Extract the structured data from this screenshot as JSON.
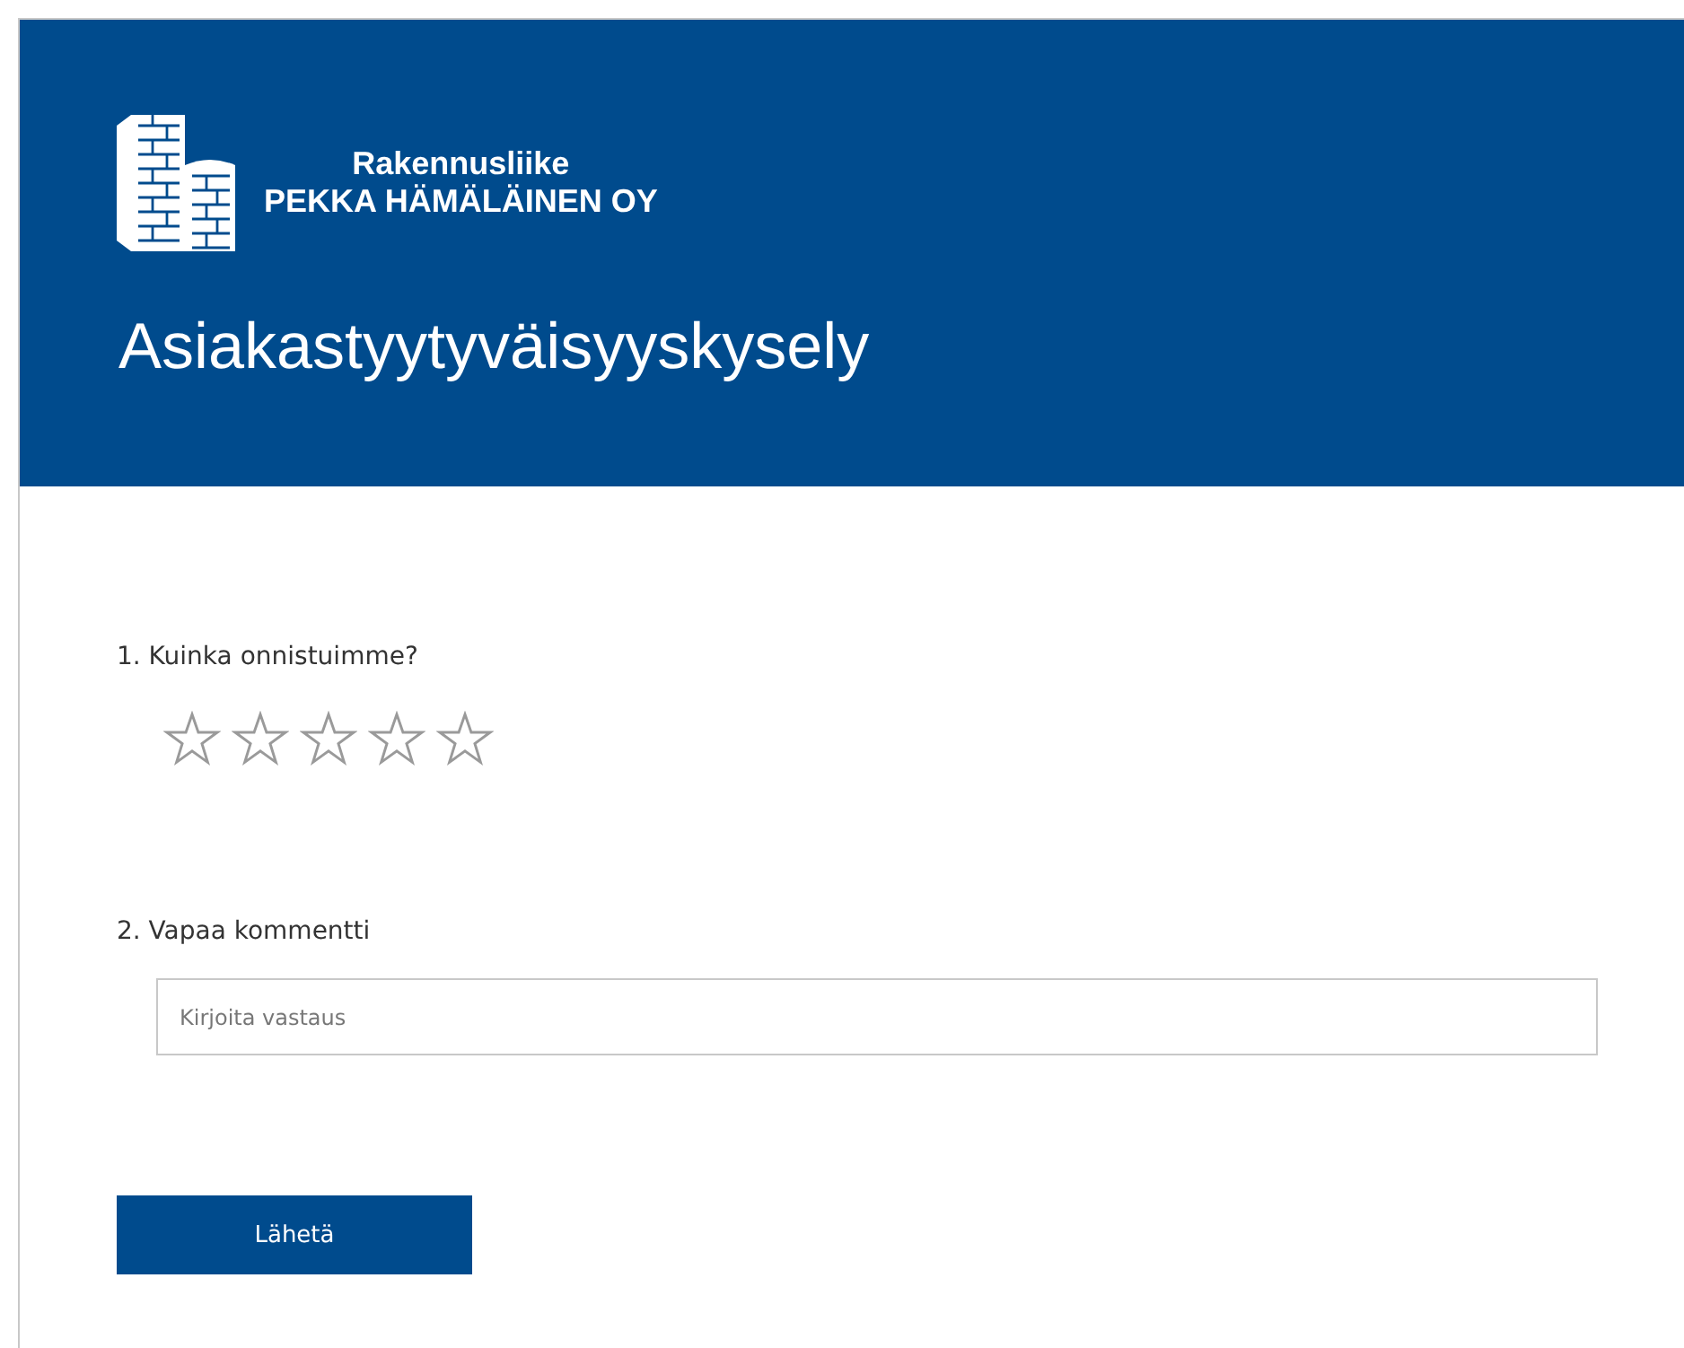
{
  "header": {
    "company_line1": "Rakennusliike",
    "company_line2": "PEKKA HÄMÄLÄINEN OY",
    "title": "Asiakastyytyväisyyskysely"
  },
  "questions": [
    {
      "kind": "rating",
      "number": "1.",
      "label": "Kuinka onnistuimme?",
      "stars": 0
    },
    {
      "kind": "text",
      "number": "2.",
      "label": "Vapaa kommentti",
      "placeholder": "Kirjoita vastaus"
    }
  ],
  "submit": {
    "label": "Lähetä"
  }
}
